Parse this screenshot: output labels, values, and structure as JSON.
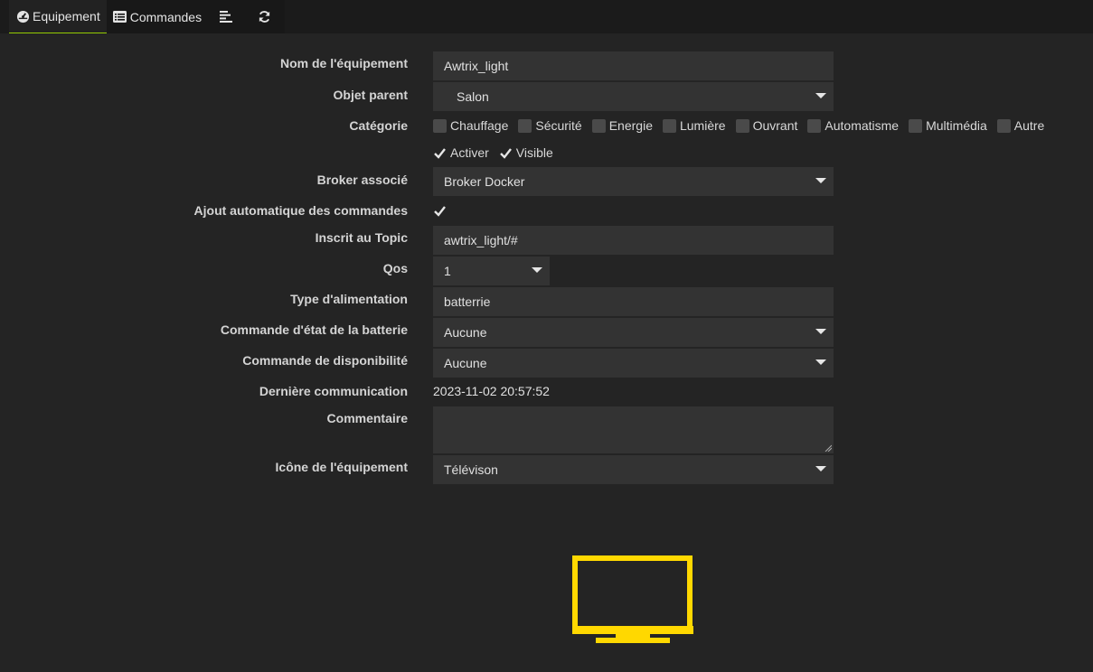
{
  "tabs": [
    {
      "label": "Equipement",
      "icon": "gauge-icon"
    },
    {
      "label": "Commandes",
      "icon": "list-icon"
    },
    {
      "label": "",
      "icon": "align-left-icon"
    },
    {
      "label": "",
      "icon": "refresh-icon"
    }
  ],
  "form": {
    "name": {
      "label": "Nom de l'équipement",
      "value": "Awtrix_light"
    },
    "parent": {
      "label": "Objet parent",
      "value": "Salon"
    },
    "category": {
      "label": "Catégorie",
      "options": [
        "Chauffage",
        "Sécurité",
        "Energie",
        "Lumière",
        "Ouvrant",
        "Automatisme",
        "Multimédia",
        "Autre"
      ]
    },
    "activate": {
      "label": "Activer",
      "checked": true
    },
    "visible": {
      "label": "Visible",
      "checked": true
    },
    "broker": {
      "label": "Broker associé",
      "value": "Broker Docker"
    },
    "auto_add": {
      "label": "Ajout automatique des commandes",
      "checked": true
    },
    "topic": {
      "label": "Inscrit au Topic",
      "value": "awtrix_light/#"
    },
    "qos": {
      "label": "Qos",
      "value": "1"
    },
    "power": {
      "label": "Type d'alimentation",
      "value": "batterrie"
    },
    "battery_cmd": {
      "label": "Commande d'état de la batterie",
      "value": "Aucune"
    },
    "avail_cmd": {
      "label": "Commande de disponibilité",
      "value": "Aucune"
    },
    "last_comm": {
      "label": "Dernière communication",
      "value": "2023-11-02 20:57:52"
    },
    "comment": {
      "label": "Commentaire",
      "value": ""
    },
    "icon": {
      "label": "Icône de l'équipement",
      "value": "Télévison"
    }
  },
  "colors": {
    "accent": "#94ca02",
    "icon_yellow": "#ffd800",
    "background": "#242424",
    "field": "#333333"
  },
  "preview_icon": "television-icon"
}
